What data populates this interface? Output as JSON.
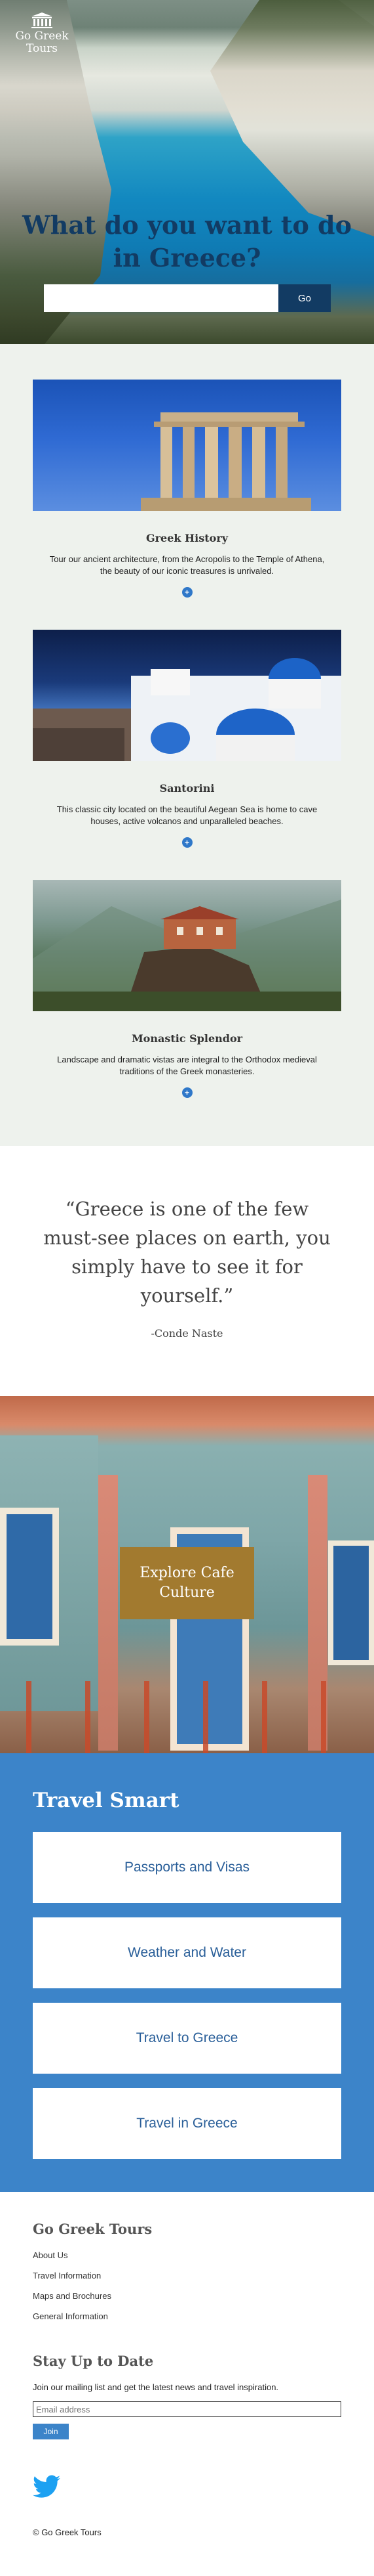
{
  "brand": {
    "logo_text": "Go Greek Tours",
    "logo_icon": "temple-icon"
  },
  "hero": {
    "title": "What do you want to do in Greece?",
    "search_placeholder": "",
    "search_value": "",
    "search_button": "Go"
  },
  "tours": [
    {
      "title": "Greek History",
      "description": "Tour our ancient architecture, from the Acropolis to the Temple of Athena, the beauty of our iconic treasures is unrivaled.",
      "more_icon": "plus-circle-icon"
    },
    {
      "title": "Santorini",
      "description": "This classic city located on the beautiful Aegean Sea is home to cave houses, active volcanos and unparalleled beaches.",
      "more_icon": "plus-circle-icon"
    },
    {
      "title": "Monastic Splendor",
      "description": "Landscape and dramatic vistas are integral to the Orthodox medieval traditions of the Greek monasteries.",
      "more_icon": "plus-circle-icon"
    }
  ],
  "quote": {
    "text": "“Greece is one of the few must-see places on earth, you simply have to see it for yourself.”",
    "source": "-Conde Naste"
  },
  "cafe": {
    "button_label": "Explore Cafe Culture"
  },
  "travel_smart": {
    "title": "Travel Smart",
    "cards": [
      "Passports and Visas",
      "Weather and Water",
      "Travel to Greece",
      "Travel in Greece"
    ]
  },
  "footer": {
    "brand": "Go Greek Tours",
    "links": [
      "About Us",
      "Travel Information",
      "Maps and Brochures",
      "General Information"
    ],
    "stay_title": "Stay Up to Date",
    "stay_description": "Join our mailing list and get the latest news and travel inspiration.",
    "email_placeholder": "Email address",
    "join_button": "Join",
    "social_icon": "twitter-icon",
    "copyright": "© Go Greek Tours"
  },
  "colors": {
    "navy": "#123b63",
    "blue_accent": "#3c84c9",
    "gold_button": "#a27a2f",
    "tours_bg": "#eef2ed"
  }
}
